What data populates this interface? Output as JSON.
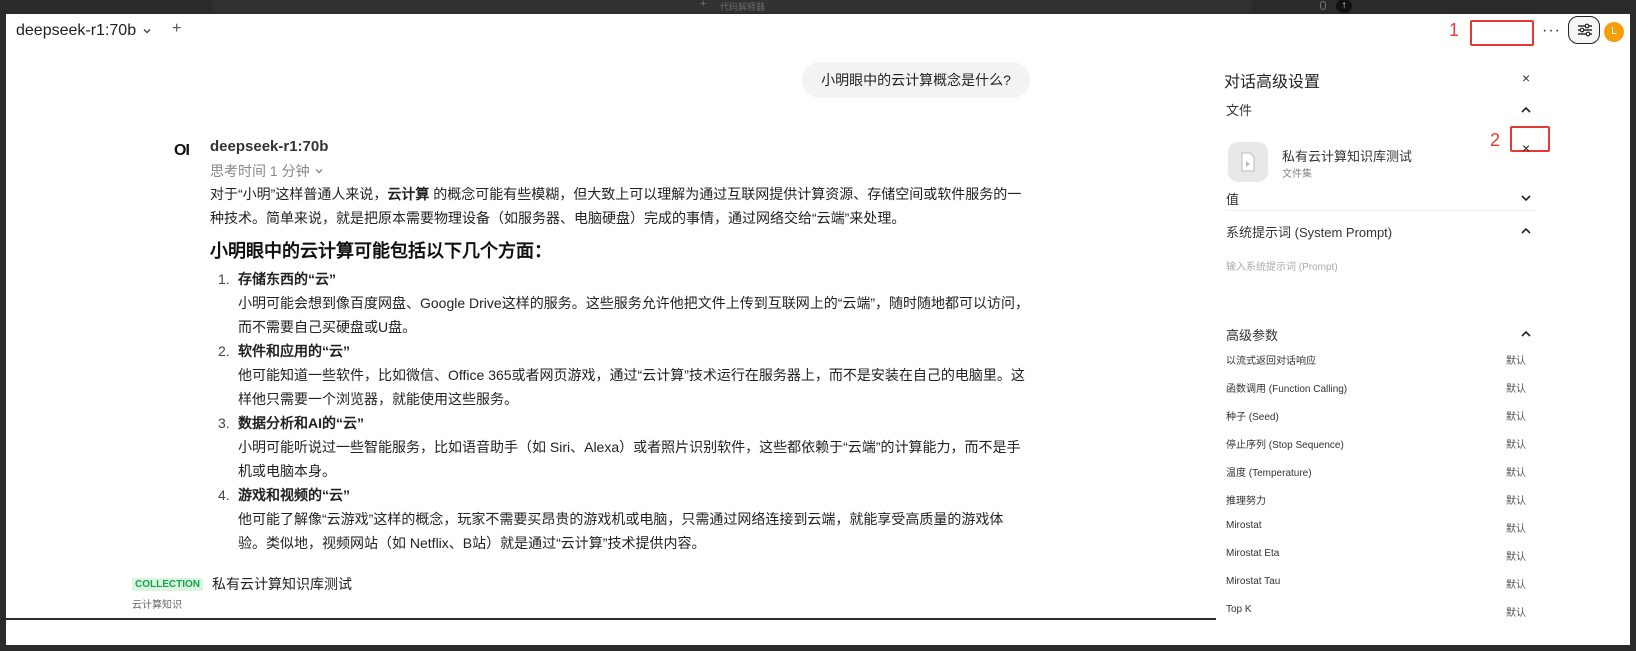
{
  "header": {
    "model_name": "deepseek-r1:70b",
    "add_model": "+",
    "more": "···",
    "avatar_initial": "L",
    "annotation_1": "1",
    "annotation_2": "2"
  },
  "ghost_toolbar": {
    "plus": "+",
    "text": "代码解释器"
  },
  "chat": {
    "user_message": "小明眼中的云计算概念是什么?",
    "bot_logo": "OI",
    "bot_name": "deepseek-r1:70b",
    "thinking": "思考时间 1 分钟",
    "intro_part1": "对于“小明”这样普通人来说，",
    "intro_bold": "云计算",
    "intro_part2": " 的概念可能有些模糊，但大致上可以理解为通过互联网提供计算资源、存储空间或软件服务的一种技术。简单来说，就是把原本需要物理设备（如服务器、电脑硬盘）完成的事情，通过网络交给“云端”来处理。",
    "heading": "小明眼中的云计算可能包括以下几个方面：",
    "items": [
      {
        "num": "1.",
        "title": "存储东西的“云”",
        "body": "小明可能会想到像百度网盘、Google Drive这样的服务。这些服务允许他把文件上传到互联网上的“云端”，随时随地都可以访问，而不需要自己买硬盘或U盘。"
      },
      {
        "num": "2.",
        "title": "软件和应用的“云”",
        "body": "他可能知道一些软件，比如微信、Office 365或者网页游戏，通过“云计算”技术运行在服务器上，而不是安装在自己的电脑里。这样他只需要一个浏览器，就能使用这些服务。"
      },
      {
        "num": "3.",
        "title": "数据分析和AI的“云”",
        "body": "小明可能听说过一些智能服务，比如语音助手（如 Siri、Alexa）或者照片识别软件，这些都依赖于“云端”的计算能力，而不是手机或电脑本身。"
      },
      {
        "num": "4.",
        "title": "游戏和视频的“云”",
        "body": "他可能了解像“云游戏”这样的概念，玩家不需要买昂贵的游戏机或电脑，只需通过网络连接到云端，就能享受高质量的游戏体验。类似地，视频网站（如 Netflix、B站）就是通过“云计算”技术提供内容。"
      }
    ]
  },
  "collection": {
    "badge": "COLLECTION",
    "name": "私有云计算知识库测试",
    "description": "云计算知识"
  },
  "panel": {
    "title": "对话高级设置",
    "close": "×",
    "files_label": "文件",
    "file_name": "私有云计算知识库测试",
    "file_type": "文件集",
    "file_remove": "×",
    "valves_label": "值",
    "system_prompt_label": "系统提示词 (System Prompt)",
    "system_prompt_placeholder": "输入系统提示词 (Prompt)",
    "advanced_label": "高级参数",
    "params": [
      {
        "name": "以流式返回对话响应",
        "value": "默认"
      },
      {
        "name": "函数调用 (Function Calling)",
        "value": "默认"
      },
      {
        "name": "种子 (Seed)",
        "value": "默认"
      },
      {
        "name": "停止序列 (Stop Sequence)",
        "value": "默认"
      },
      {
        "name": "温度 (Temperature)",
        "value": "默认"
      },
      {
        "name": "推理努力",
        "value": "默认"
      },
      {
        "name": "Mirostat",
        "value": "默认"
      },
      {
        "name": "Mirostat Eta",
        "value": "默认"
      },
      {
        "name": "Mirostat Tau",
        "value": "默认"
      },
      {
        "name": "Top K",
        "value": "默认"
      }
    ]
  },
  "colors": {
    "annotation": "#e53935",
    "avatar": "#f59e0b",
    "collection_badge_bg": "#dcf5e3",
    "collection_badge_fg": "#16a34a"
  }
}
